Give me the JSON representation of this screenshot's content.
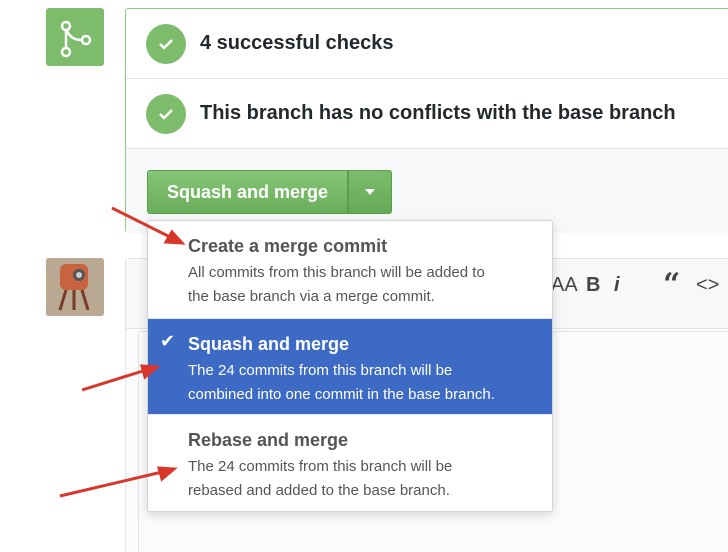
{
  "status": {
    "checks": "4 successful checks",
    "conflicts": "This branch has no conflicts with the base branch"
  },
  "merge_button": {
    "label": "Squash and merge"
  },
  "toolbar": {
    "heading": "AA",
    "bold": "B",
    "italic": "i",
    "quote": "“",
    "code": "<>"
  },
  "menu": {
    "items": [
      {
        "title": "Create a merge commit",
        "desc1": "All commits from this branch will be added to",
        "desc2": "the base branch via a merge commit.",
        "selected": false
      },
      {
        "title": "Squash and merge",
        "desc1": "The 24 commits from this branch will be",
        "desc2": "combined into one commit in the base branch.",
        "selected": true
      },
      {
        "title": "Rebase and merge",
        "desc1": "The 24 commits from this branch will be",
        "desc2": "rebased and added to the base branch.",
        "selected": false
      }
    ]
  },
  "colors": {
    "green": "#7cbc6b",
    "selected": "#3c6ac4",
    "arrow": "#d9362b"
  }
}
